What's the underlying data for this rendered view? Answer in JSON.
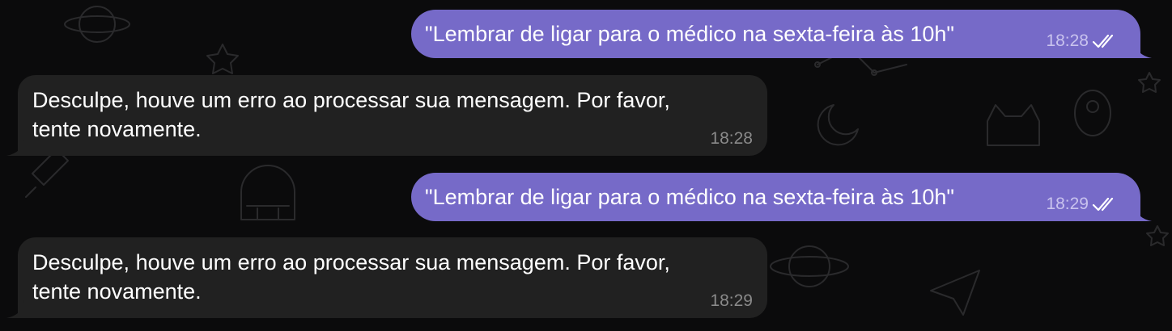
{
  "chat": {
    "messages": [
      {
        "direction": "outgoing",
        "text": "\"Lembrar de ligar para o médico na sexta-feira às 10h\"",
        "time": "18:28",
        "status_icon": "double-check-icon"
      },
      {
        "direction": "incoming",
        "text": "Desculpe, houve um erro ao processar sua mensagem. Por favor,\ntente novamente.",
        "time": "18:28"
      },
      {
        "direction": "outgoing",
        "text": "\"Lembrar de ligar para o médico na sexta-feira às 10h\"",
        "time": "18:29",
        "status_icon": "double-check-icon"
      },
      {
        "direction": "incoming",
        "text": "Desculpe, houve um erro ao processar sua mensagem. Por favor,\ntente novamente.",
        "time": "18:29"
      }
    ]
  },
  "colors": {
    "background": "#0b0b0c",
    "outgoing_bubble": "#766ac8",
    "incoming_bubble": "#212121",
    "text": "#ffffff",
    "incoming_time": "#8a8a8a",
    "outgoing_time": "#c9c3ee"
  }
}
